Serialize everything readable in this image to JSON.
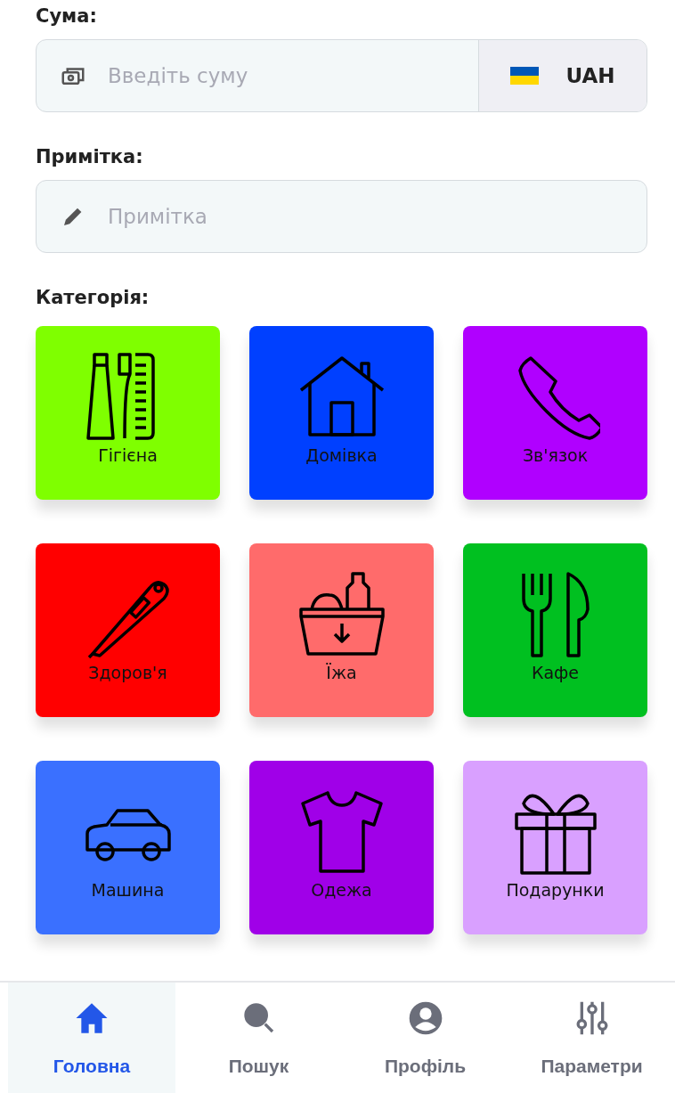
{
  "amount": {
    "label": "Сума:",
    "placeholder": "Введіть суму",
    "currency": "UAH"
  },
  "note": {
    "label": "Примітка:",
    "placeholder": "Примітка"
  },
  "category": {
    "label": "Категорія:",
    "items": [
      {
        "label": "Гігієна",
        "color": "#7fff00"
      },
      {
        "label": "Домівка",
        "color": "#0040ff"
      },
      {
        "label": "Зв'язок",
        "color": "#b000ff"
      },
      {
        "label": "Здоров'я",
        "color": "#ff0000"
      },
      {
        "label": "Їжа",
        "color": "#ff6b6b"
      },
      {
        "label": "Кафе",
        "color": "#00c020"
      },
      {
        "label": "Машина",
        "color": "#3a70ff"
      },
      {
        "label": "Одежа",
        "color": "#a000e8"
      },
      {
        "label": "Подарунки",
        "color": "#d9a0ff"
      }
    ]
  },
  "nav": [
    {
      "label": "Головна",
      "selected": true
    },
    {
      "label": "Пошук",
      "selected": false
    },
    {
      "label": "Профіль",
      "selected": false
    },
    {
      "label": "Параметри",
      "selected": false
    }
  ]
}
